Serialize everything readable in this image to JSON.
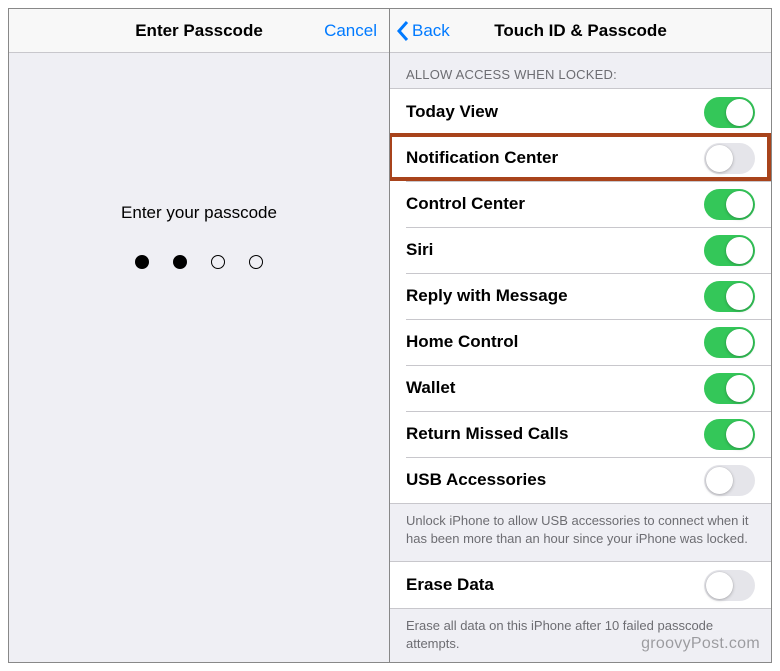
{
  "left": {
    "title": "Enter Passcode",
    "cancel": "Cancel",
    "prompt": "Enter your passcode",
    "dots_entered": 2,
    "dots_total": 4
  },
  "right": {
    "back_label": "Back",
    "title": "Touch ID & Passcode",
    "section_header": "ALLOW ACCESS WHEN LOCKED:",
    "options": [
      {
        "label": "Today View",
        "on": true,
        "highlighted": false
      },
      {
        "label": "Notification Center",
        "on": false,
        "highlighted": true
      },
      {
        "label": "Control Center",
        "on": true,
        "highlighted": false
      },
      {
        "label": "Siri",
        "on": true,
        "highlighted": false
      },
      {
        "label": "Reply with Message",
        "on": true,
        "highlighted": false
      },
      {
        "label": "Home Control",
        "on": true,
        "highlighted": false
      },
      {
        "label": "Wallet",
        "on": true,
        "highlighted": false
      },
      {
        "label": "Return Missed Calls",
        "on": true,
        "highlighted": false
      },
      {
        "label": "USB Accessories",
        "on": false,
        "highlighted": false
      }
    ],
    "footer1": "Unlock iPhone to allow USB accessories to connect when it has been more than an hour since your iPhone was locked.",
    "erase_label": "Erase Data",
    "erase_on": false,
    "footer2": "Erase all data on this iPhone after 10 failed passcode attempts."
  },
  "watermark": "groovyPost.com"
}
